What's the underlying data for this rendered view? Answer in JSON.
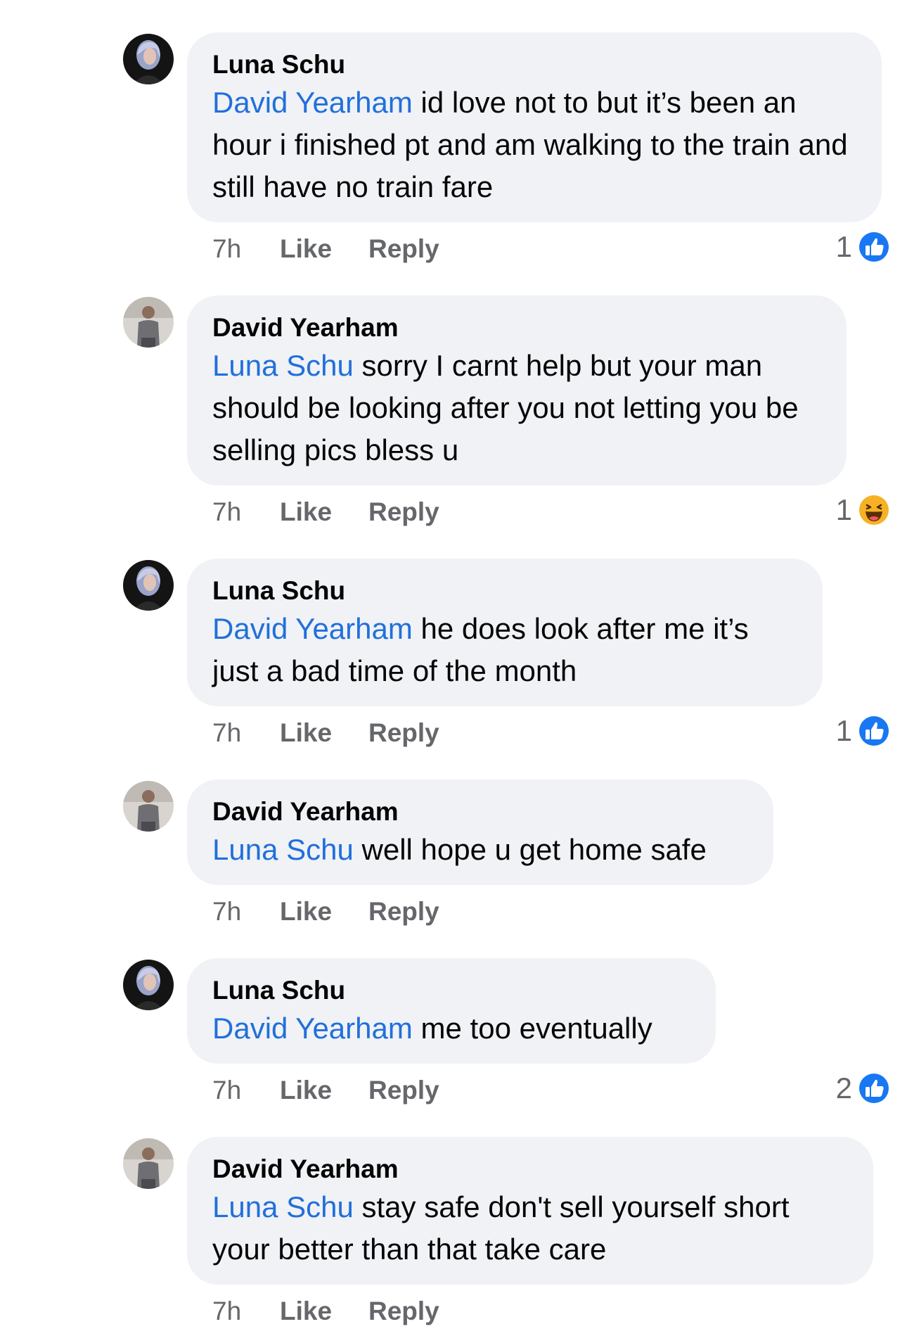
{
  "colors": {
    "mention": "#216fdb",
    "bubble_bg": "#f0f2f5",
    "meta_text": "#65676b",
    "like_blue": "#1877f2",
    "haha_yellow": "#f7b125"
  },
  "comments": [
    {
      "author": "Luna Schu",
      "mention": "David Yearham",
      "text": " id love not to but it’s been an hour i finished pt and am walking to the train and still have no train fare",
      "time": "7h",
      "like_label": "Like",
      "reply_label": "Reply",
      "reaction": {
        "count": "1",
        "icon": "like-icon"
      }
    },
    {
      "author": "David Yearham",
      "mention": "Luna Schu",
      "text": " sorry I carnt help but your man should be looking after you not letting you be selling pics bless u",
      "time": "7h",
      "like_label": "Like",
      "reply_label": "Reply",
      "reaction": {
        "count": "1",
        "icon": "haha-icon"
      }
    },
    {
      "author": "Luna Schu",
      "mention": "David Yearham",
      "text": " he does look after me it’s just a bad time of the month",
      "time": "7h",
      "like_label": "Like",
      "reply_label": "Reply",
      "reaction": {
        "count": "1",
        "icon": "like-icon"
      }
    },
    {
      "author": "David Yearham",
      "mention": "Luna Schu",
      "text": " well hope u get home safe",
      "time": "7h",
      "like_label": "Like",
      "reply_label": "Reply"
    },
    {
      "author": "Luna Schu",
      "mention": "David Yearham",
      "text": " me too eventually",
      "time": "7h",
      "like_label": "Like",
      "reply_label": "Reply",
      "reaction": {
        "count": "2",
        "icon": "like-icon"
      }
    },
    {
      "author": "David Yearham",
      "mention": "Luna Schu",
      "text": " stay safe don't sell yourself short your better than that take care",
      "time": "7h",
      "like_label": "Like",
      "reply_label": "Reply"
    }
  ]
}
